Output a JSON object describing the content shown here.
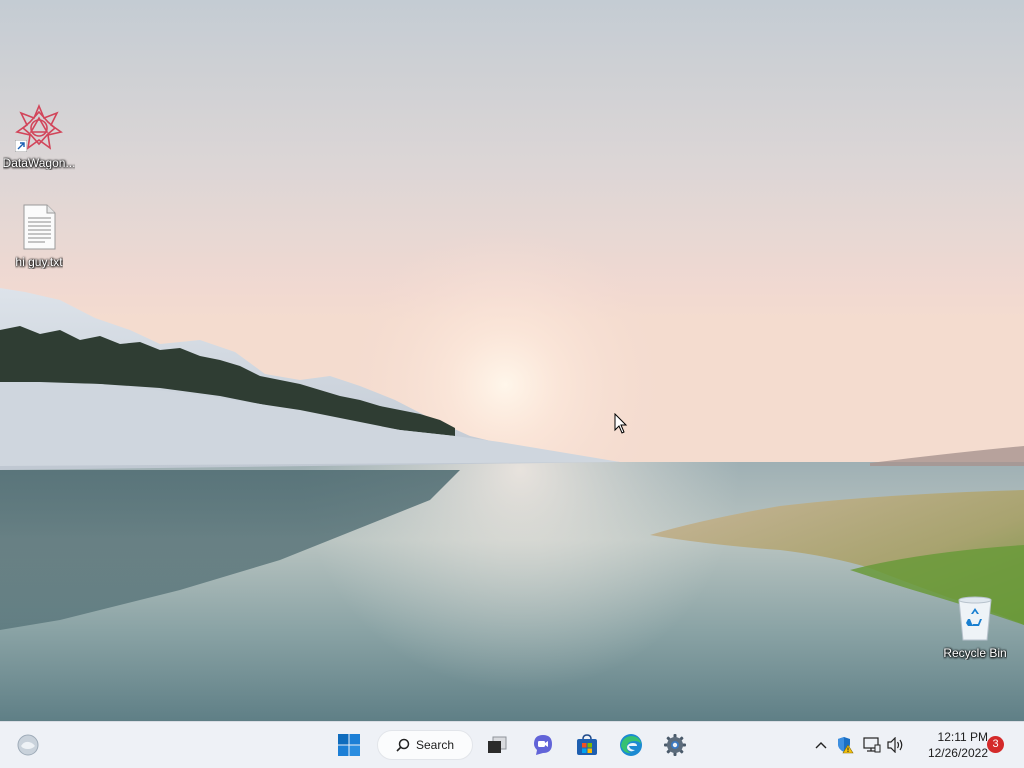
{
  "desktop": {
    "icons": [
      {
        "label": "DataWagon...",
        "icon": "datawagon-app-icon",
        "shortcut": true
      },
      {
        "label": "hi guy.txt",
        "icon": "text-file-icon"
      },
      {
        "label": "Recycle Bin",
        "icon": "recycle-bin-icon"
      }
    ]
  },
  "taskbar": {
    "search_label": "Search",
    "pinned": [
      "widgets",
      "start",
      "search",
      "task-view",
      "chat",
      "microsoft-store",
      "edge",
      "settings"
    ],
    "tray": {
      "time": "12:11 PM",
      "date": "12/26/2022",
      "notification_count": "3"
    }
  },
  "colors": {
    "taskbar_bg": "#eef1f6",
    "start_blue": "#0f6cbd",
    "badge_red": "#d42a2a"
  }
}
